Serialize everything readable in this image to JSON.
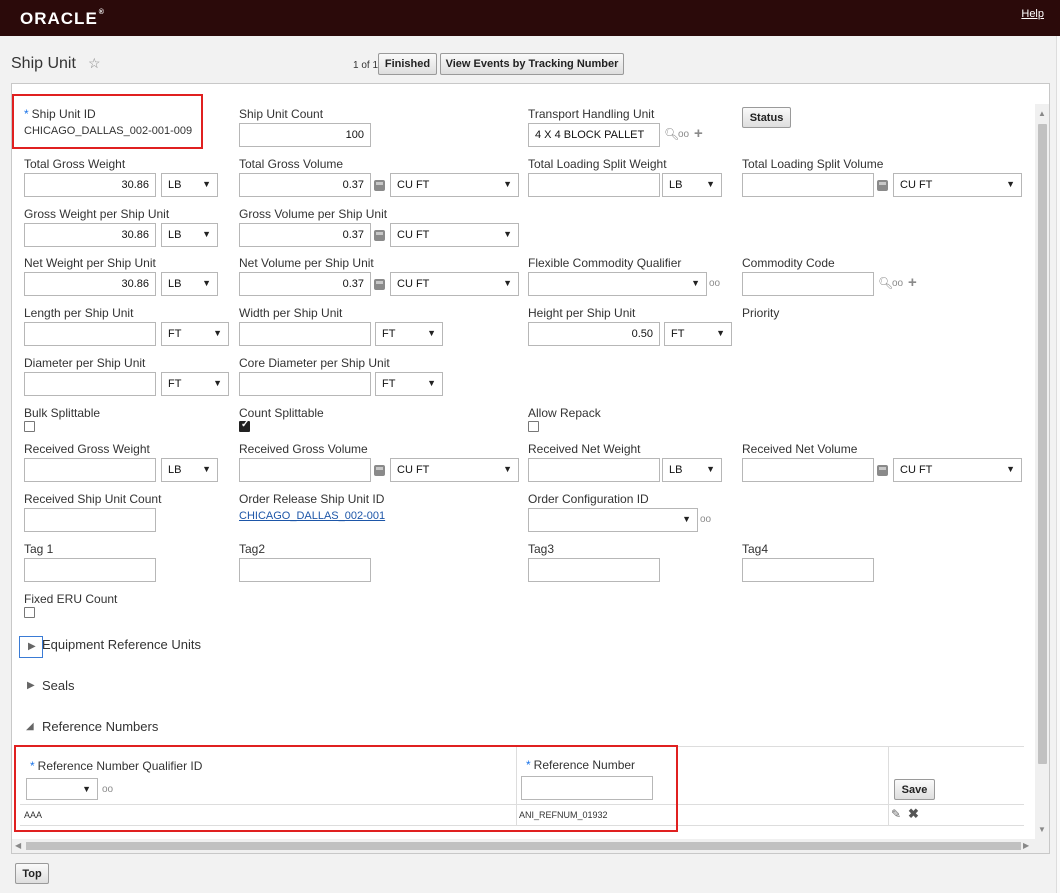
{
  "app": {
    "logo": "ORACLE",
    "help": "Help"
  },
  "page": {
    "title": "Ship Unit",
    "pager": "1 of 1"
  },
  "buttons": {
    "finished": "Finished",
    "view_events": "View Events by Tracking Number",
    "status": "Status",
    "save": "Save",
    "top": "Top"
  },
  "fields": {
    "ship_unit_id": {
      "label": "Ship Unit ID",
      "value": "CHICAGO_DALLAS_002-001-009"
    },
    "ship_unit_count": {
      "label": "Ship Unit Count",
      "value": "100"
    },
    "transport_handling_unit": {
      "label": "Transport Handling Unit",
      "value": "4 X 4 BLOCK PALLET"
    },
    "total_gross_weight": {
      "label": "Total Gross Weight",
      "value": "30.86",
      "unit": "LB"
    },
    "total_gross_volume": {
      "label": "Total Gross Volume",
      "value": "0.37",
      "unit": "CU FT"
    },
    "total_loading_split_weight": {
      "label": "Total Loading Split Weight",
      "value": "",
      "unit": "LB"
    },
    "total_loading_split_volume": {
      "label": "Total Loading Split Volume",
      "value": "",
      "unit": "CU FT"
    },
    "gross_weight_per_su": {
      "label": "Gross Weight per Ship Unit",
      "value": "30.86",
      "unit": "LB"
    },
    "gross_volume_per_su": {
      "label": "Gross Volume per Ship Unit",
      "value": "0.37",
      "unit": "CU FT"
    },
    "net_weight_per_su": {
      "label": "Net Weight per Ship Unit",
      "value": "30.86",
      "unit": "LB"
    },
    "net_volume_per_su": {
      "label": "Net Volume per Ship Unit",
      "value": "0.37",
      "unit": "CU FT"
    },
    "flexible_commodity_qualifier": {
      "label": "Flexible Commodity Qualifier",
      "value": ""
    },
    "commodity_code": {
      "label": "Commodity Code",
      "value": ""
    },
    "length_per_su": {
      "label": "Length per Ship Unit",
      "value": "",
      "unit": "FT"
    },
    "width_per_su": {
      "label": "Width per Ship Unit",
      "value": "",
      "unit": "FT"
    },
    "height_per_su": {
      "label": "Height per Ship Unit",
      "value": "0.50",
      "unit": "FT"
    },
    "priority": {
      "label": "Priority"
    },
    "diameter_per_su": {
      "label": "Diameter per Ship Unit",
      "value": "",
      "unit": "FT"
    },
    "core_diameter_per_su": {
      "label": "Core Diameter per Ship Unit",
      "value": "",
      "unit": "FT"
    },
    "bulk_splittable": {
      "label": "Bulk Splittable",
      "checked": false
    },
    "count_splittable": {
      "label": "Count Splittable",
      "checked": true
    },
    "allow_repack": {
      "label": "Allow Repack",
      "checked": false
    },
    "received_gross_weight": {
      "label": "Received Gross Weight",
      "value": "",
      "unit": "LB"
    },
    "received_gross_volume": {
      "label": "Received Gross Volume",
      "value": "",
      "unit": "CU FT"
    },
    "received_net_weight": {
      "label": "Received Net Weight",
      "value": "",
      "unit": "LB"
    },
    "received_net_volume": {
      "label": "Received Net Volume",
      "value": "",
      "unit": "CU FT"
    },
    "received_su_count": {
      "label": "Received Ship Unit Count",
      "value": ""
    },
    "order_release_su_id": {
      "label": "Order Release Ship Unit ID",
      "value": "CHICAGO_DALLAS_002-001"
    },
    "order_config_id": {
      "label": "Order Configuration ID",
      "value": ""
    },
    "tag1": {
      "label": "Tag 1",
      "value": ""
    },
    "tag2": {
      "label": "Tag2",
      "value": ""
    },
    "tag3": {
      "label": "Tag3",
      "value": ""
    },
    "tag4": {
      "label": "Tag4",
      "value": ""
    },
    "fixed_eru_count": {
      "label": "Fixed ERU Count",
      "checked": false
    }
  },
  "sections": {
    "equipment": "Equipment Reference Units",
    "seals": "Seals",
    "reference_numbers": "Reference Numbers"
  },
  "ref_table": {
    "col_qualifier": "Reference Number Qualifier ID",
    "col_number": "Reference Number",
    "rows": [
      {
        "qualifier": "AAA",
        "number": "ANI_REFNUM_01932"
      }
    ]
  },
  "colors": {
    "topbar": "#2b0a0a",
    "highlight": "#e02020",
    "link": "#1d56a8"
  }
}
